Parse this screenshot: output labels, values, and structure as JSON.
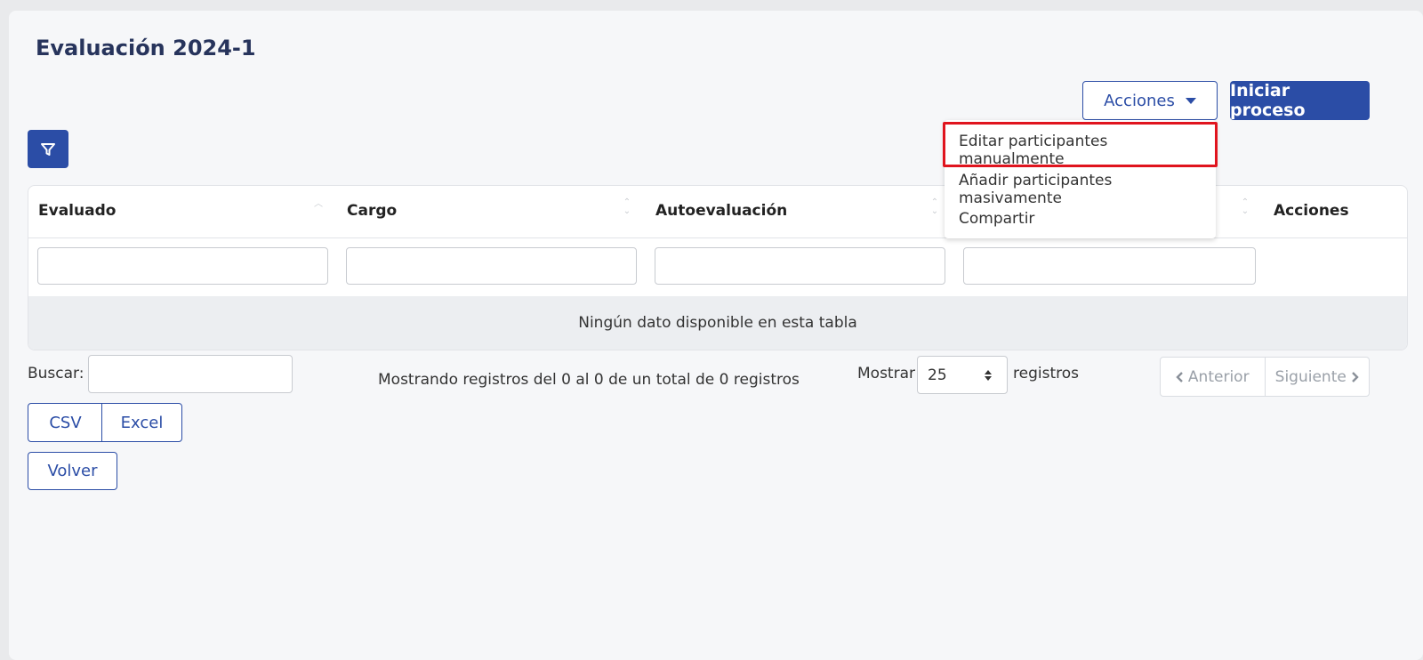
{
  "page": {
    "title": "Evaluación 2024-1"
  },
  "toolbar": {
    "actions_label": "Acciones",
    "start_label": "Iniciar proceso"
  },
  "dropdown": {
    "items": [
      "Editar participantes manualmente",
      "Añadir participantes masivamente",
      "Compartir"
    ],
    "highlighted_item": "Editar participantes manualmente",
    "highlight_color": "#e0141e"
  },
  "table": {
    "columns": [
      "Evaluado",
      "Cargo",
      "Autoevaluación",
      "",
      "Acciones"
    ],
    "empty_message": "Ningún dato disponible en esta tabla"
  },
  "search": {
    "label": "Buscar:",
    "value": ""
  },
  "info": {
    "text": "Mostrando registros del 0 al 0 de un total de 0 registros"
  },
  "length": {
    "prefix": "Mostrar",
    "value": "25",
    "suffix": "registros"
  },
  "pagination": {
    "previous": "Anterior",
    "next": "Siguiente"
  },
  "export": {
    "csv": "CSV",
    "excel": "Excel"
  },
  "back": {
    "label": "Volver"
  },
  "colors": {
    "primary": "#2b4da6",
    "title": "#27345c",
    "background": "#f6f7f9"
  },
  "icons": {
    "filter": "filter-icon",
    "caret": "caret-down-icon",
    "sort": "sort-icon"
  }
}
